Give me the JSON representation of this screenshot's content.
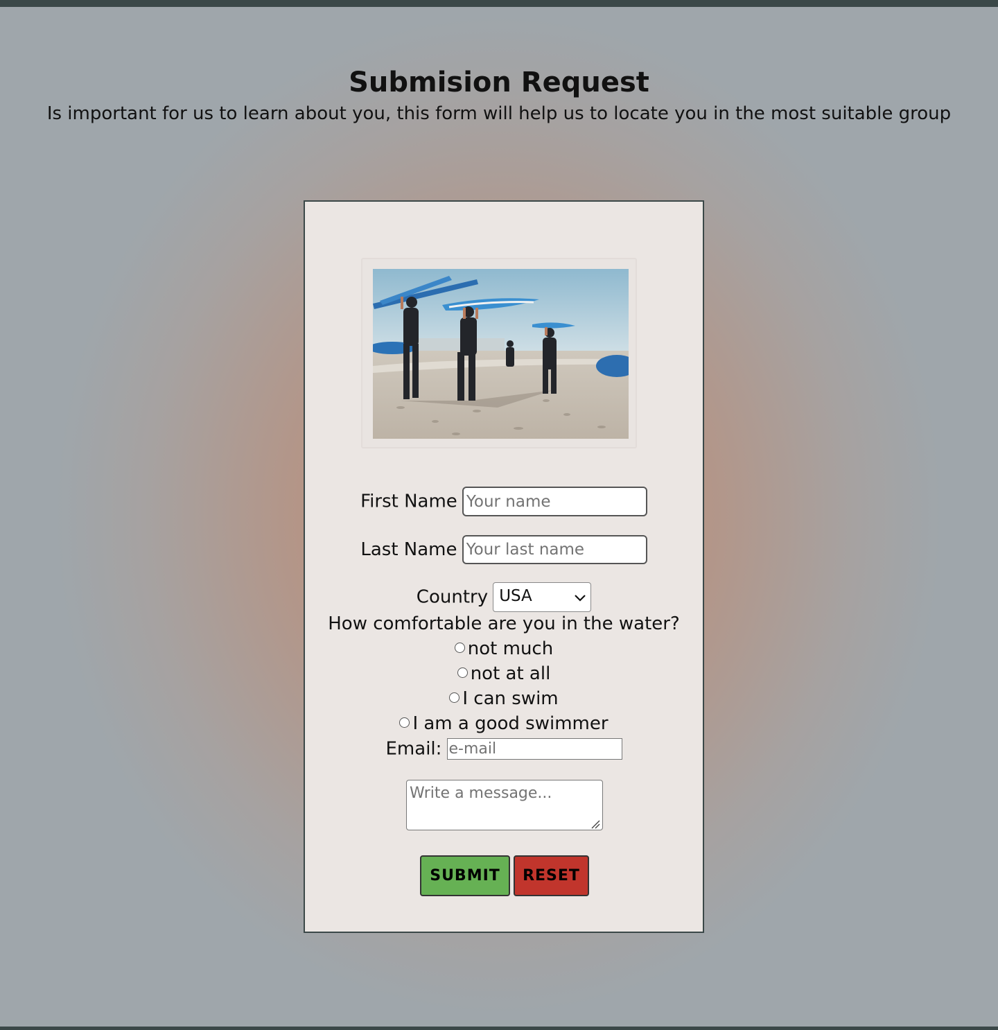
{
  "header": {
    "title": "Submision Request",
    "subtitle": "Is important for us to learn about you, this form will help us to locate you in the most suitable group"
  },
  "form": {
    "first_name": {
      "label": "First Name",
      "placeholder": "Your name"
    },
    "last_name": {
      "label": "Last Name",
      "placeholder": "Your last name"
    },
    "country": {
      "label": "Country",
      "selected": "USA"
    },
    "comfort": {
      "question": "How comfortable are you in the water?",
      "options": [
        "not much",
        "not at all",
        "I can swim",
        "I am a good swimmer"
      ]
    },
    "email": {
      "label": "Email:",
      "placeholder": "e-mail"
    },
    "message": {
      "placeholder": "Write a message..."
    },
    "submit_label": "SUBMIT",
    "reset_label": "RESET"
  },
  "colors": {
    "submit": "#66b154",
    "reset": "#c1352c",
    "card": "#ebe6e3",
    "accent_dark": "#3b4848"
  },
  "icons": {
    "select": "chevron-down-icon",
    "textarea": "resize-grip-icon"
  }
}
